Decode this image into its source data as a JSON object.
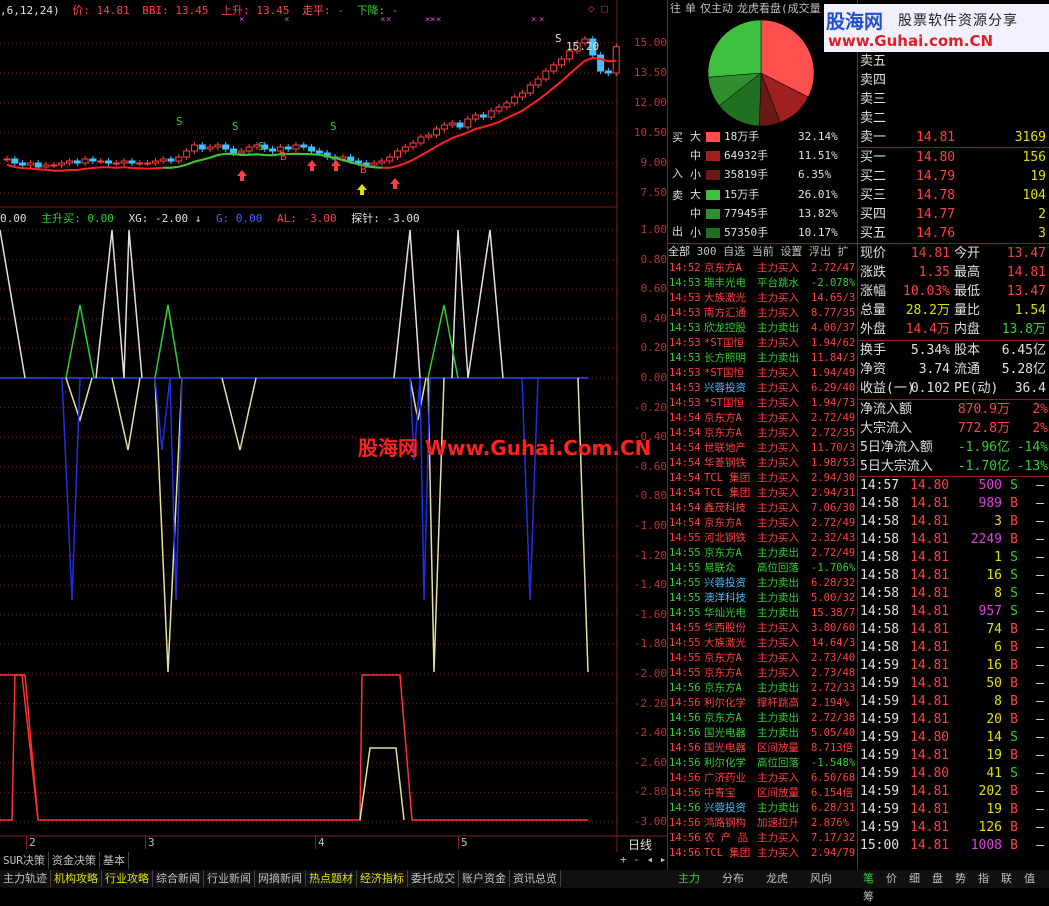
{
  "chart_top": {
    "code_prefix": ",6,12,24)",
    "price_label": "价: 14.81",
    "bbi_label": "BBI: 13.45",
    "up_label": "上升: 13.45",
    "flat_label": "走平: -",
    "down_label": "下降: -",
    "right_markers": "◇ □",
    "y_axis": [
      "15.00",
      "13.50",
      "12.00",
      "10.50",
      "9.00",
      "7.50"
    ],
    "high_label": "15.20",
    "b_label": "B",
    "s_label": "S"
  },
  "indicator": {
    "prefix": "0.00",
    "main_up": "主升买: 0.00",
    "xg": "XG: -2.00",
    "arrow": "↓",
    "g": "G: 0.00",
    "al": "AL: -3.00",
    "tanzhen": "探针: -3.00",
    "y_axis": [
      "1.00",
      "0.80",
      "0.60",
      "0.40",
      "0.20",
      "0.00",
      "-0.20",
      "-0.40",
      "-0.60",
      "-0.80",
      "-1.00",
      "-1.20",
      "-1.40",
      "-1.60",
      "-1.80",
      "-2.00",
      "-2.20",
      "-2.40",
      "-2.60",
      "-2.80",
      "-3.00"
    ]
  },
  "watermark": "股海网 Www.Guhai.Com.CN",
  "x_axis": [
    "2",
    "3",
    "4",
    "5"
  ],
  "x_axis_right": "日线",
  "bottom_tabs_row1": [
    "SUR决策",
    "资金决策",
    "基本"
  ],
  "bottom_tabs_row2": [
    "主力轨迹",
    "机构攻略",
    "行业攻略",
    "综合新闻",
    "行业新闻",
    "网摘新闻",
    "热点题材",
    "经济指标",
    "委托成交",
    "账户资金",
    "资讯总览"
  ],
  "mid_tabs": [
    "往",
    "单",
    "仅主动",
    "龙虎看盘(成交量"
  ],
  "pie_colors": [
    "#ff5050",
    "#a02020",
    "#6a1818",
    "#207020",
    "#309030",
    "#40c040"
  ],
  "pie_values": [
    32.14,
    11.51,
    6.35,
    13.82,
    9.17,
    26.01
  ],
  "flows": [
    {
      "side": "买",
      "dir": "入",
      "rows": [
        {
          "size": "大",
          "vol": "18万手",
          "pct": "32.14%",
          "color": "#ff5050"
        },
        {
          "size": "中",
          "vol": "64932手",
          "pct": "11.51%",
          "color": "#a02020"
        },
        {
          "size": "小",
          "vol": "35819手",
          "pct": "6.35%",
          "color": "#6a1818"
        }
      ]
    },
    {
      "side": "卖",
      "dir": "出",
      "rows": [
        {
          "size": "大",
          "vol": "15万手",
          "pct": "26.01%",
          "color": "#40c040"
        },
        {
          "size": "中",
          "vol": "77945手",
          "pct": "13.82%",
          "color": "#309030"
        },
        {
          "size": "小",
          "vol": "57350手",
          "pct": "10.17%",
          "color": "#207020"
        }
      ]
    }
  ],
  "tick_tabs": [
    "全部",
    "300",
    "自选",
    "当前",
    "设置",
    "浮出",
    "扩"
  ],
  "ticks": [
    {
      "t": "14:52",
      "n": "京东方A",
      "a": "主力买入",
      "v": "2.72/47"
    },
    {
      "t": "14:53",
      "n": "瑞丰光电",
      "a": "平台跳水",
      "v": "-2.078%"
    },
    {
      "t": "14:53",
      "n": "大族激光",
      "a": "主力买入",
      "v": "14.65/3"
    },
    {
      "t": "14:53",
      "n": "南方汇通",
      "a": "主力买入",
      "v": "8.77/35"
    },
    {
      "t": "14:53",
      "n": "欣龙控股",
      "a": "主力卖出",
      "v": "4.00/37"
    },
    {
      "t": "14:53",
      "n": "*ST国恒",
      "a": "主力买入",
      "v": "1.94/62"
    },
    {
      "t": "14:53",
      "n": "长方照明",
      "a": "主力卖出",
      "v": "11.84/3"
    },
    {
      "t": "14:53",
      "n": "*ST国恒",
      "a": "主力买入",
      "v": "1.94/49"
    },
    {
      "t": "14:53",
      "n": "兴蓉投资",
      "a": "主力买入",
      "v": "6.29/40"
    },
    {
      "t": "14:53",
      "n": "*ST国恒",
      "a": "主力买入",
      "v": "1.94/73"
    },
    {
      "t": "14:54",
      "n": "京东方A",
      "a": "主力买入",
      "v": "2.72/49"
    },
    {
      "t": "14:54",
      "n": "京东方A",
      "a": "主力买入",
      "v": "2.72/35"
    },
    {
      "t": "14:54",
      "n": "世联地产",
      "a": "主力买入",
      "v": "11.70/3"
    },
    {
      "t": "14:54",
      "n": "华菱钢铁",
      "a": "主力买入",
      "v": "1.98/53"
    },
    {
      "t": "14:54",
      "n": "TCL 集团",
      "a": "主力买入",
      "v": "2.94/30"
    },
    {
      "t": "14:54",
      "n": "TCL 集团",
      "a": "主力买入",
      "v": "2.94/31"
    },
    {
      "t": "14:54",
      "n": "鑫茂科技",
      "a": "主力买入",
      "v": "7.06/30"
    },
    {
      "t": "14:54",
      "n": "京东方A",
      "a": "主力买入",
      "v": "2.72/49"
    },
    {
      "t": "14:55",
      "n": "河北钢铁",
      "a": "主力买入",
      "v": "2.32/43"
    },
    {
      "t": "14:55",
      "n": "京东方A",
      "a": "主力卖出",
      "v": "2.72/49"
    },
    {
      "t": "14:55",
      "n": "易联众",
      "a": "高位回落",
      "v": "-1.706%"
    },
    {
      "t": "14:55",
      "n": "兴蓉投资",
      "a": "主力卖出",
      "v": "6.28/32"
    },
    {
      "t": "14:55",
      "n": "澳洋科技",
      "a": "主力卖出",
      "v": "5.00/32"
    },
    {
      "t": "14:55",
      "n": "华灿光电",
      "a": "主力卖出",
      "v": "15.38/7"
    },
    {
      "t": "14:55",
      "n": "华西股份",
      "a": "主力买入",
      "v": "3.80/60"
    },
    {
      "t": "14:55",
      "n": "大族激光",
      "a": "主力买入",
      "v": "14.64/3"
    },
    {
      "t": "14:55",
      "n": "京东方A",
      "a": "主力买入",
      "v": "2.73/40"
    },
    {
      "t": "14:55",
      "n": "京东方A",
      "a": "主力买入",
      "v": "2.73/48"
    },
    {
      "t": "14:56",
      "n": "京东方A",
      "a": "主力卖出",
      "v": "2.72/33"
    },
    {
      "t": "14:56",
      "n": "利尔化学",
      "a": "撑杆跳高",
      "v": "2.194%"
    },
    {
      "t": "14:56",
      "n": "京东方A",
      "a": "主力卖出",
      "v": "2.72/38"
    },
    {
      "t": "14:56",
      "n": "国光电器",
      "a": "主力卖出",
      "v": "5.05/40"
    },
    {
      "t": "14:56",
      "n": "国光电器",
      "a": "区间放量",
      "v": "8.713倍"
    },
    {
      "t": "14:56",
      "n": "利尔化学",
      "a": "高位回落",
      "v": "-1.548%"
    },
    {
      "t": "14:56",
      "n": "广济药业",
      "a": "主力买入",
      "v": "6.50/68"
    },
    {
      "t": "14:56",
      "n": "中青宝",
      "a": "区间放量",
      "v": "6.154倍"
    },
    {
      "t": "14:56",
      "n": "兴蓉投资",
      "a": "主力卖出",
      "v": "6.28/31"
    },
    {
      "t": "14:56",
      "n": "鸿路钢构",
      "a": "加速拉升",
      "v": "2.876%"
    },
    {
      "t": "14:56",
      "n": "农 产 品",
      "a": "主力买入",
      "v": "7.17/32"
    },
    {
      "t": "14:56",
      "n": "TCL 集团",
      "a": "主力买入",
      "v": "2.94/79"
    }
  ],
  "mid_bottom_tabs": [
    "主力",
    "分布",
    "龙虎",
    "风向"
  ],
  "logo_main": "股海网",
  "logo_sub": "股票软件资源分享",
  "logo_url": "www.Guhai.com.CN",
  "sells": [
    {
      "l": "卖五",
      "p": "",
      "v": ""
    },
    {
      "l": "卖四",
      "p": "",
      "v": ""
    },
    {
      "l": "卖三",
      "p": "",
      "v": ""
    },
    {
      "l": "卖二",
      "p": "",
      "v": ""
    },
    {
      "l": "卖一",
      "p": "14.81",
      "v": "3169"
    }
  ],
  "buys": [
    {
      "l": "买一",
      "p": "14.80",
      "v": "156"
    },
    {
      "l": "买二",
      "p": "14.79",
      "v": "19"
    },
    {
      "l": "买三",
      "p": "14.78",
      "v": "104"
    },
    {
      "l": "买四",
      "p": "14.77",
      "v": "2"
    },
    {
      "l": "买五",
      "p": "14.76",
      "v": "3"
    }
  ],
  "stats": [
    {
      "a": "现价",
      "b": "14.81",
      "c": "今开",
      "d": "13.47"
    },
    {
      "a": "涨跌",
      "b": "1.35",
      "c": "最高",
      "d": "14.81"
    },
    {
      "a": "涨幅",
      "b": "10.03%",
      "c": "最低",
      "d": "13.47"
    },
    {
      "a": "总量",
      "b": "28.2万",
      "c": "量比",
      "d": "1.54"
    },
    {
      "a": "外盘",
      "b": "14.4万",
      "c": "内盘",
      "d": "13.8万"
    }
  ],
  "stats2": [
    {
      "a": "换手",
      "b": "5.34%",
      "c": "股本",
      "d": "6.45亿"
    },
    {
      "a": "净资",
      "b": "3.74",
      "c": "流通",
      "d": "5.28亿"
    },
    {
      "a": "收益(一)",
      "b": "0.102",
      "c": "PE(动)",
      "d": "36.4"
    }
  ],
  "flows2": [
    {
      "a": "净流入额",
      "b": "870.9万",
      "c": "2%"
    },
    {
      "a": "大宗流入",
      "b": "772.8万",
      "c": "2%"
    },
    {
      "a": "5日净流入额",
      "b": "-1.96亿",
      "c": "-14%"
    },
    {
      "a": "5日大宗流入",
      "b": "-1.70亿",
      "c": "-13%"
    }
  ],
  "trades": [
    {
      "t": "14:57",
      "p": "14.80",
      "v": "500",
      "s": "S"
    },
    {
      "t": "14:58",
      "p": "14.81",
      "v": "989",
      "s": "B"
    },
    {
      "t": "14:58",
      "p": "14.81",
      "v": "3",
      "s": "B"
    },
    {
      "t": "14:58",
      "p": "14.81",
      "v": "2249",
      "s": "B"
    },
    {
      "t": "14:58",
      "p": "14.81",
      "v": "1",
      "s": "S"
    },
    {
      "t": "14:58",
      "p": "14.81",
      "v": "16",
      "s": "S"
    },
    {
      "t": "14:58",
      "p": "14.81",
      "v": "8",
      "s": "S"
    },
    {
      "t": "14:58",
      "p": "14.81",
      "v": "957",
      "s": "S"
    },
    {
      "t": "14:58",
      "p": "14.81",
      "v": "74",
      "s": "B"
    },
    {
      "t": "14:58",
      "p": "14.81",
      "v": "6",
      "s": "B"
    },
    {
      "t": "14:59",
      "p": "14.81",
      "v": "16",
      "s": "B"
    },
    {
      "t": "14:59",
      "p": "14.81",
      "v": "50",
      "s": "B"
    },
    {
      "t": "14:59",
      "p": "14.81",
      "v": "8",
      "s": "B"
    },
    {
      "t": "14:59",
      "p": "14.81",
      "v": "20",
      "s": "B"
    },
    {
      "t": "14:59",
      "p": "14.80",
      "v": "14",
      "s": "S"
    },
    {
      "t": "14:59",
      "p": "14.81",
      "v": "19",
      "s": "B"
    },
    {
      "t": "14:59",
      "p": "14.80",
      "v": "41",
      "s": "S"
    },
    {
      "t": "14:59",
      "p": "14.81",
      "v": "202",
      "s": "B"
    },
    {
      "t": "14:59",
      "p": "14.81",
      "v": "19",
      "s": "B"
    },
    {
      "t": "14:59",
      "p": "14.81",
      "v": "126",
      "s": "B"
    },
    {
      "t": "15:00",
      "p": "14.81",
      "v": "1008",
      "s": "B"
    }
  ],
  "right_bottom_tabs": [
    "笔",
    "价",
    "细",
    "盘",
    "势",
    "指",
    "联",
    "值",
    "筹"
  ]
}
